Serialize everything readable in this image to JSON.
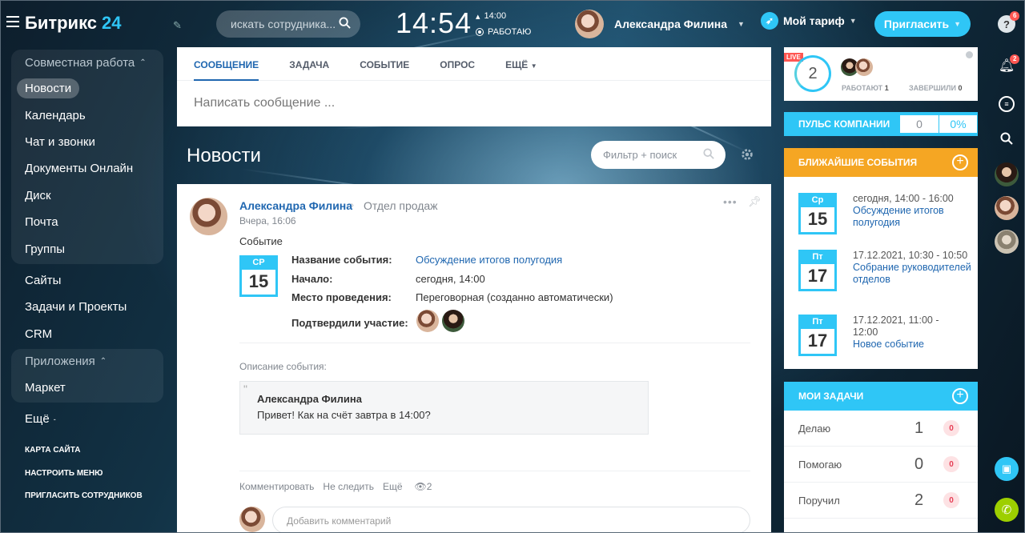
{
  "header": {
    "logo": "Битрикс",
    "logo_num": "24",
    "search_placeholder": "искать сотрудника...",
    "clock": "14:54",
    "work_time": "14:00",
    "work_status": "РАБОТАЮ",
    "user_name": "Александра Филина",
    "tariff": "Мой тариф",
    "invite": "Пригласить"
  },
  "menu": {
    "group1": "Совместная работа",
    "items1": [
      "Новости",
      "Календарь",
      "Чат и звонки",
      "Документы Онлайн",
      "Диск",
      "Почта",
      "Группы"
    ],
    "items2": [
      "Сайты",
      "Задачи и Проекты",
      "CRM"
    ],
    "group2": "Приложения",
    "items3": [
      "Маркет"
    ],
    "more": "Ещё",
    "footer": [
      "КАРТА САЙТА",
      "НАСТРОИТЬ МЕНЮ",
      "ПРИГЛАСИТЬ СОТРУДНИКОВ"
    ]
  },
  "composer": {
    "tabs": [
      "СООБЩЕНИЕ",
      "ЗАДАЧА",
      "СОБЫТИЕ",
      "ОПРОС",
      "ЕЩЁ"
    ],
    "placeholder": "Написать сообщение ..."
  },
  "feed": {
    "title": "Новости",
    "filter_placeholder": "Фильтр + поиск"
  },
  "post": {
    "author": "Александра Филина",
    "dept": "Отдел продаж",
    "time": "Вчера, 16:06",
    "type": "Событие",
    "cal_weekday": "СР",
    "cal_day": "15",
    "labels": {
      "name": "Название события:",
      "start": "Начало:",
      "place": "Место проведения:",
      "confirmed": "Подтвердили участие:"
    },
    "values": {
      "name": "Обсуждение итогов полугодия",
      "start": "сегодня, 14:00",
      "place": "Переговорная (созданно автоматически)"
    },
    "desc_label": "Описание события:",
    "quote_author": "Александра Филина",
    "quote_text": "Привет! Как на счёт завтра в 14:00?",
    "actions": [
      "Комментировать",
      "Не следить",
      "Ещё"
    ],
    "views": "2",
    "comment_placeholder": "Добавить комментарий"
  },
  "live": {
    "badge": "LIVE",
    "count": "2",
    "working_label": "РАБОТАЮТ",
    "working": "1",
    "finished_label": "ЗАВЕРШИЛИ",
    "finished": "0"
  },
  "pulse": {
    "label": "ПУЛЬС КОМПАНИИ",
    "value": "0",
    "percent": "0%"
  },
  "events": {
    "title": "БЛИЖАЙШИЕ СОБЫТИЯ",
    "items": [
      {
        "weekday": "Ср",
        "day": "15",
        "when": "сегодня, 14:00 - 16:00",
        "name": "Обсуждение итогов полугодия"
      },
      {
        "weekday": "Пт",
        "day": "17",
        "when": "17.12.2021, 10:30 - 10:50",
        "name": "Собрание руководителей отделов"
      },
      {
        "weekday": "Пт",
        "day": "17",
        "when": "17.12.2021, 11:00 - 12:00",
        "name": "Новое событие"
      }
    ]
  },
  "tasks": {
    "title": "МОИ ЗАДАЧИ",
    "rows": [
      {
        "label": "Делаю",
        "count": "1",
        "expired": "0"
      },
      {
        "label": "Помогаю",
        "count": "0",
        "expired": "0"
      },
      {
        "label": "Поручил",
        "count": "2",
        "expired": "0"
      }
    ]
  },
  "rightbar": {
    "help_badge": "6",
    "notif_badge": "2"
  },
  "colors": {
    "accent": "#2fc6f6",
    "link": "#2067b0",
    "events": "#f5a623",
    "live": "#ff5752"
  }
}
